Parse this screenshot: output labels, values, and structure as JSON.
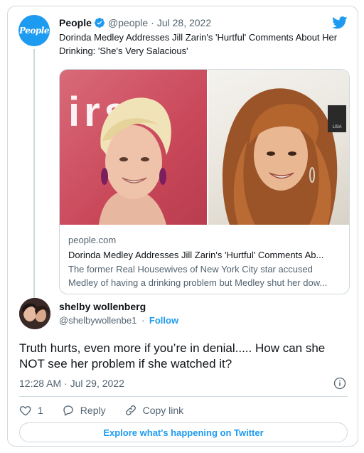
{
  "quoted": {
    "avatar_text": "People",
    "name": "People",
    "handle": "@people",
    "separator": "·",
    "date": "Jul 28, 2022",
    "text": "Dorinda Medley Addresses Jill Zarin's 'Hurtful' Comments About Her Drinking: 'She's Very Salacious'",
    "link_card": {
      "image_left_text": "irs",
      "image_right_text": "LISA",
      "domain": "people.com",
      "title": "Dorinda Medley Addresses Jill Zarin's 'Hurtful' Comments Ab...",
      "description": "The former Real Housewives of New York City star accused Medley of having a drinking problem but Medley shut her dow..."
    }
  },
  "reply": {
    "name": "shelby wollenberg",
    "handle": "@shelbywollenbe1",
    "separator": "·",
    "follow_label": "Follow",
    "text": "Truth hurts, even more if you’re in denial..... How can she NOT see her problem if she watched it?",
    "timestamp": "12:28 AM · Jul 29, 2022"
  },
  "actions": {
    "like_count": "1",
    "reply_label": "Reply",
    "copy_label": "Copy link"
  },
  "explore_label": "Explore what's happening on Twitter",
  "colors": {
    "accent": "#1d9bf0",
    "text": "#0f1419",
    "muted": "#536471",
    "border": "#cfd9de",
    "like_red": "#f91880"
  },
  "icons": [
    "verified-badge-icon",
    "twitter-bird-icon",
    "info-icon",
    "heart-icon",
    "reply-icon",
    "link-icon"
  ]
}
